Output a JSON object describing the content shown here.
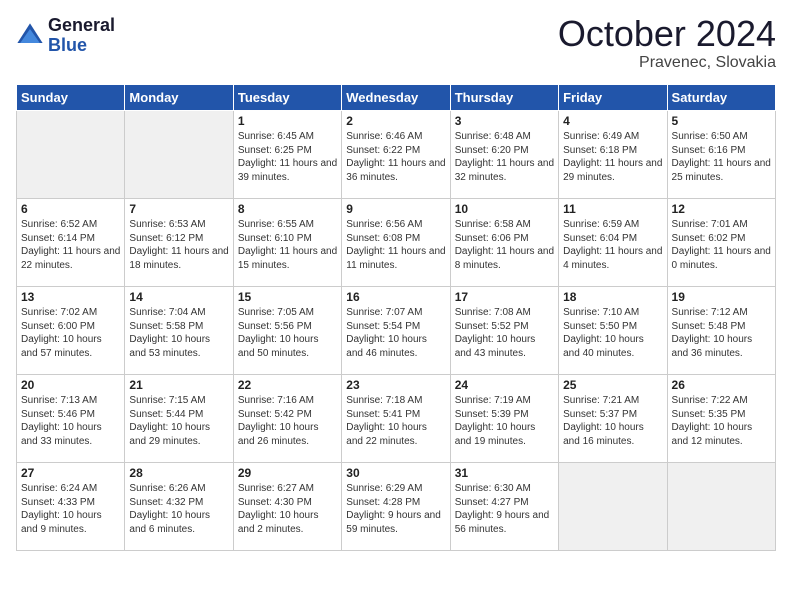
{
  "logo": {
    "line1": "General",
    "line2": "Blue"
  },
  "title": "October 2024",
  "location": "Pravenec, Slovakia",
  "weekdays": [
    "Sunday",
    "Monday",
    "Tuesday",
    "Wednesday",
    "Thursday",
    "Friday",
    "Saturday"
  ],
  "weeks": [
    [
      {
        "day": "",
        "empty": true
      },
      {
        "day": "",
        "empty": true
      },
      {
        "day": "1",
        "sunrise": "6:45 AM",
        "sunset": "6:25 PM",
        "daylight": "11 hours and 39 minutes."
      },
      {
        "day": "2",
        "sunrise": "6:46 AM",
        "sunset": "6:22 PM",
        "daylight": "11 hours and 36 minutes."
      },
      {
        "day": "3",
        "sunrise": "6:48 AM",
        "sunset": "6:20 PM",
        "daylight": "11 hours and 32 minutes."
      },
      {
        "day": "4",
        "sunrise": "6:49 AM",
        "sunset": "6:18 PM",
        "daylight": "11 hours and 29 minutes."
      },
      {
        "day": "5",
        "sunrise": "6:50 AM",
        "sunset": "6:16 PM",
        "daylight": "11 hours and 25 minutes."
      }
    ],
    [
      {
        "day": "6",
        "sunrise": "6:52 AM",
        "sunset": "6:14 PM",
        "daylight": "11 hours and 22 minutes."
      },
      {
        "day": "7",
        "sunrise": "6:53 AM",
        "sunset": "6:12 PM",
        "daylight": "11 hours and 18 minutes."
      },
      {
        "day": "8",
        "sunrise": "6:55 AM",
        "sunset": "6:10 PM",
        "daylight": "11 hours and 15 minutes."
      },
      {
        "day": "9",
        "sunrise": "6:56 AM",
        "sunset": "6:08 PM",
        "daylight": "11 hours and 11 minutes."
      },
      {
        "day": "10",
        "sunrise": "6:58 AM",
        "sunset": "6:06 PM",
        "daylight": "11 hours and 8 minutes."
      },
      {
        "day": "11",
        "sunrise": "6:59 AM",
        "sunset": "6:04 PM",
        "daylight": "11 hours and 4 minutes."
      },
      {
        "day": "12",
        "sunrise": "7:01 AM",
        "sunset": "6:02 PM",
        "daylight": "11 hours and 0 minutes."
      }
    ],
    [
      {
        "day": "13",
        "sunrise": "7:02 AM",
        "sunset": "6:00 PM",
        "daylight": "10 hours and 57 minutes."
      },
      {
        "day": "14",
        "sunrise": "7:04 AM",
        "sunset": "5:58 PM",
        "daylight": "10 hours and 53 minutes."
      },
      {
        "day": "15",
        "sunrise": "7:05 AM",
        "sunset": "5:56 PM",
        "daylight": "10 hours and 50 minutes."
      },
      {
        "day": "16",
        "sunrise": "7:07 AM",
        "sunset": "5:54 PM",
        "daylight": "10 hours and 46 minutes."
      },
      {
        "day": "17",
        "sunrise": "7:08 AM",
        "sunset": "5:52 PM",
        "daylight": "10 hours and 43 minutes."
      },
      {
        "day": "18",
        "sunrise": "7:10 AM",
        "sunset": "5:50 PM",
        "daylight": "10 hours and 40 minutes."
      },
      {
        "day": "19",
        "sunrise": "7:12 AM",
        "sunset": "5:48 PM",
        "daylight": "10 hours and 36 minutes."
      }
    ],
    [
      {
        "day": "20",
        "sunrise": "7:13 AM",
        "sunset": "5:46 PM",
        "daylight": "10 hours and 33 minutes."
      },
      {
        "day": "21",
        "sunrise": "7:15 AM",
        "sunset": "5:44 PM",
        "daylight": "10 hours and 29 minutes."
      },
      {
        "day": "22",
        "sunrise": "7:16 AM",
        "sunset": "5:42 PM",
        "daylight": "10 hours and 26 minutes."
      },
      {
        "day": "23",
        "sunrise": "7:18 AM",
        "sunset": "5:41 PM",
        "daylight": "10 hours and 22 minutes."
      },
      {
        "day": "24",
        "sunrise": "7:19 AM",
        "sunset": "5:39 PM",
        "daylight": "10 hours and 19 minutes."
      },
      {
        "day": "25",
        "sunrise": "7:21 AM",
        "sunset": "5:37 PM",
        "daylight": "10 hours and 16 minutes."
      },
      {
        "day": "26",
        "sunrise": "7:22 AM",
        "sunset": "5:35 PM",
        "daylight": "10 hours and 12 minutes."
      }
    ],
    [
      {
        "day": "27",
        "sunrise": "6:24 AM",
        "sunset": "4:33 PM",
        "daylight": "10 hours and 9 minutes."
      },
      {
        "day": "28",
        "sunrise": "6:26 AM",
        "sunset": "4:32 PM",
        "daylight": "10 hours and 6 minutes."
      },
      {
        "day": "29",
        "sunrise": "6:27 AM",
        "sunset": "4:30 PM",
        "daylight": "10 hours and 2 minutes."
      },
      {
        "day": "30",
        "sunrise": "6:29 AM",
        "sunset": "4:28 PM",
        "daylight": "9 hours and 59 minutes."
      },
      {
        "day": "31",
        "sunrise": "6:30 AM",
        "sunset": "4:27 PM",
        "daylight": "9 hours and 56 minutes."
      },
      {
        "day": "",
        "empty": true
      },
      {
        "day": "",
        "empty": true
      }
    ]
  ]
}
